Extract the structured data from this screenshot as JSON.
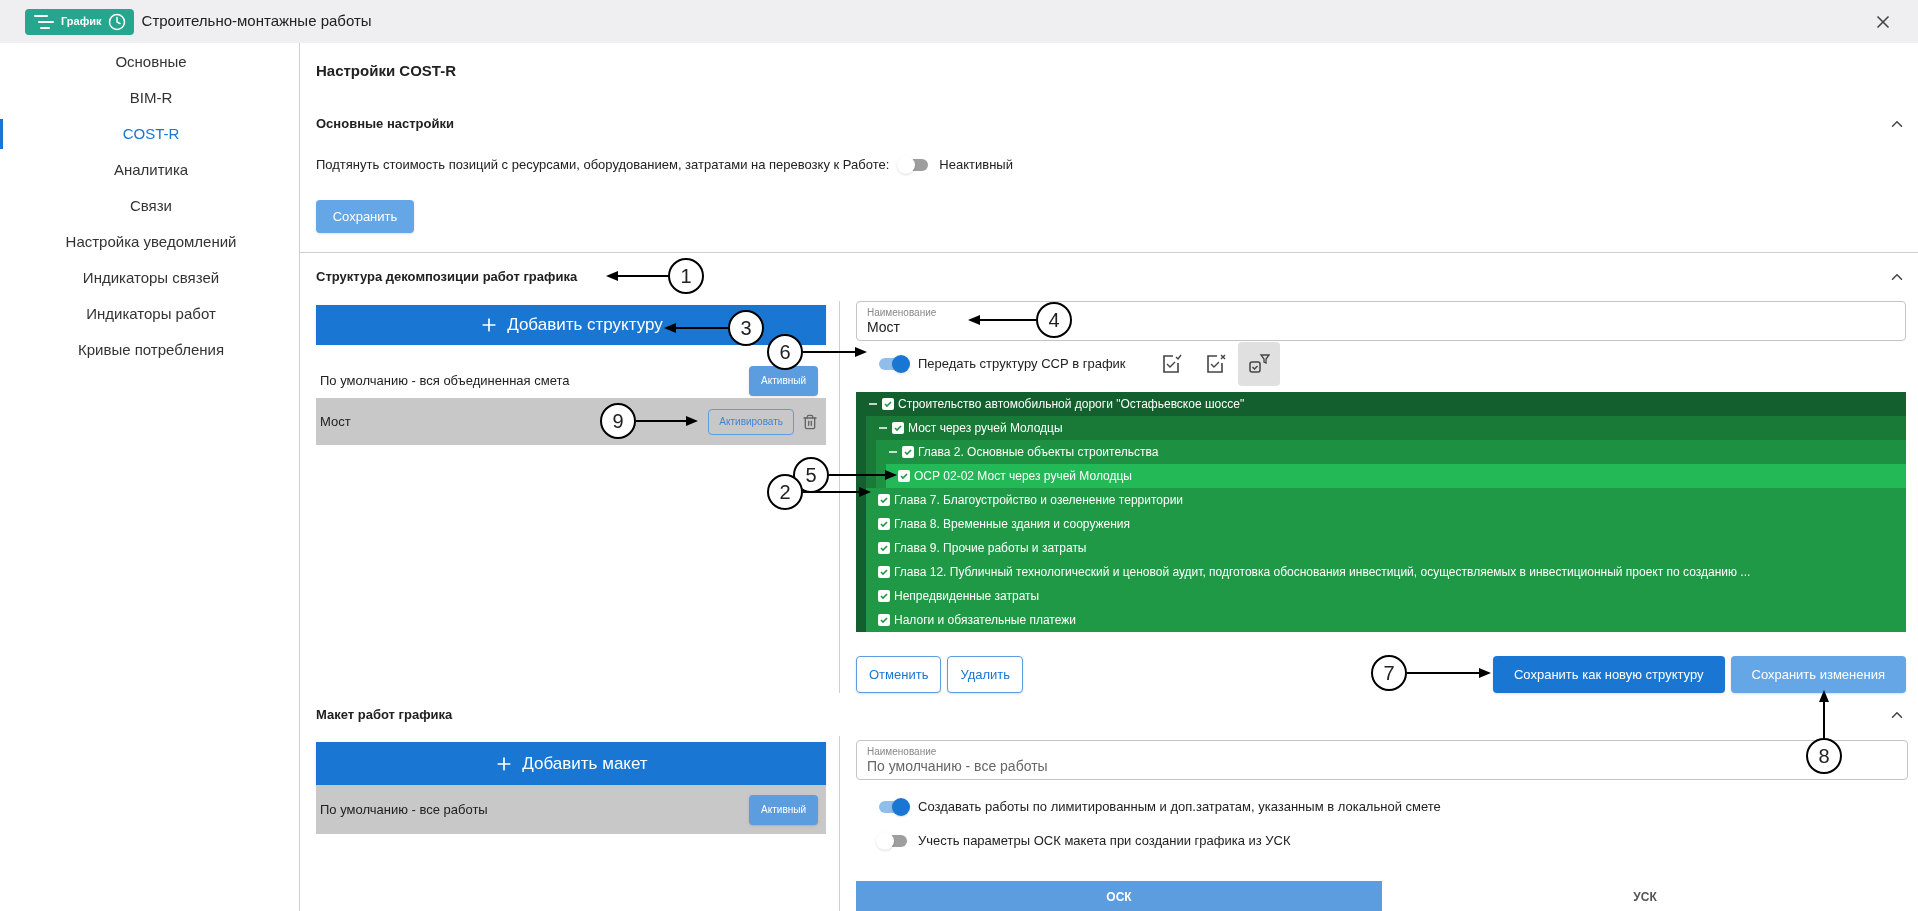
{
  "header": {
    "logo_label": "График",
    "title": "Строительно-монтажные работы"
  },
  "sidebar": {
    "items": [
      {
        "label": "Основные",
        "selected": false
      },
      {
        "label": "BIM-R",
        "selected": false
      },
      {
        "label": "COST-R",
        "selected": true
      },
      {
        "label": "Аналитика",
        "selected": false
      },
      {
        "label": "Связи",
        "selected": false
      },
      {
        "label": "Настройка уведомлений",
        "selected": false
      },
      {
        "label": "Индикаторы связей",
        "selected": false
      },
      {
        "label": "Индикаторы работ",
        "selected": false
      },
      {
        "label": "Кривые потребления",
        "selected": false
      }
    ]
  },
  "page_title": "Настройки COST-R",
  "basic": {
    "title": "Основные настройки",
    "expanded": true,
    "option": {
      "label": "Подтянуть стоимость позиций с ресурсами, оборудованием, затратами на перевозку к Работе:",
      "on": false,
      "state_text": "Неактивный"
    },
    "save_button": {
      "label": "Сохранить",
      "disabled": true
    }
  },
  "wbs": {
    "title": "Структура декомпозиции работ графика",
    "expanded": true,
    "add_button": "Добавить структуру",
    "structures": [
      {
        "name": "По умолчанию - вся объединенная смета",
        "selected": false,
        "button": "Активный",
        "kind": "active",
        "deletable": false
      },
      {
        "name": "Мост",
        "selected": true,
        "button": "Активировать",
        "kind": "inactive",
        "deletable": true
      }
    ],
    "name_field": {
      "label": "Наименование",
      "value": "Мост"
    },
    "transfer": {
      "label": "Передать структуру ССР в график",
      "on": true
    },
    "filter_on": true,
    "tree": [
      {
        "label": "Строительство автомобильной дороги \"Остафьевское шоссе\"",
        "checked": true,
        "expanded": true,
        "selected": false,
        "children": [
          {
            "label": "Мост через ручей Молодцы",
            "checked": true,
            "expanded": true,
            "selected": false,
            "children": [
              {
                "label": "Глава 2. Основные объекты строительства",
                "checked": true,
                "expanded": true,
                "selected": false,
                "children": [
                  {
                    "label": "ОСР 02-02 Мост через ручей Молодцы",
                    "checked": true,
                    "selected": true
                  }
                ]
              }
            ]
          },
          {
            "label": "Глава 7. Благоустройство и озеленение территории",
            "checked": true,
            "selected": false
          },
          {
            "label": "Глава 8. Временные здания и сооружения",
            "checked": true,
            "selected": false
          },
          {
            "label": "Глава 9. Прочие работы и затраты",
            "checked": true,
            "selected": false
          },
          {
            "label": "Глава 12. Публичный технологический и ценовой аудит, подготовка обоснования инвестиций, осуществляемых в инвестиционный проект по созданию ...",
            "checked": true,
            "selected": false
          },
          {
            "label": "Непредвиденные затраты",
            "checked": true,
            "selected": false
          },
          {
            "label": "Налоги и обязательные платежи",
            "checked": true,
            "selected": false
          }
        ]
      }
    ],
    "left_buttons": [
      {
        "label": "Отменить",
        "kind": "outline",
        "disabled": false
      },
      {
        "label": "Удалить",
        "kind": "outline",
        "disabled": false
      }
    ],
    "right_buttons": [
      {
        "label": "Сохранить как новую структуру",
        "kind": "primary",
        "disabled": false
      },
      {
        "label": "Сохранить изменения",
        "kind": "primary",
        "disabled": true
      }
    ]
  },
  "layout": {
    "title": "Макет работ графика",
    "expanded": true,
    "add_button": "Добавить макет",
    "layouts": [
      {
        "name": "По умолчанию - все работы",
        "selected": true,
        "button": "Активный",
        "kind": "active",
        "deletable": false
      }
    ],
    "name_field": {
      "label": "Наименование",
      "value": "По умолчанию - все работы"
    },
    "options": [
      {
        "label": "Создавать работы по лимитированным и доп.затратам, указанным в локальной смете",
        "on": true
      },
      {
        "label": "Учесть параметры ОСК макета при создании графика из УСК",
        "on": false
      }
    ],
    "tabs": [
      {
        "label": "ОСК",
        "selected": true
      },
      {
        "label": "УСК",
        "selected": false
      }
    ]
  },
  "callouts": [
    "1",
    "4",
    "3",
    "6",
    "9",
    "5",
    "2",
    "7",
    "8"
  ]
}
